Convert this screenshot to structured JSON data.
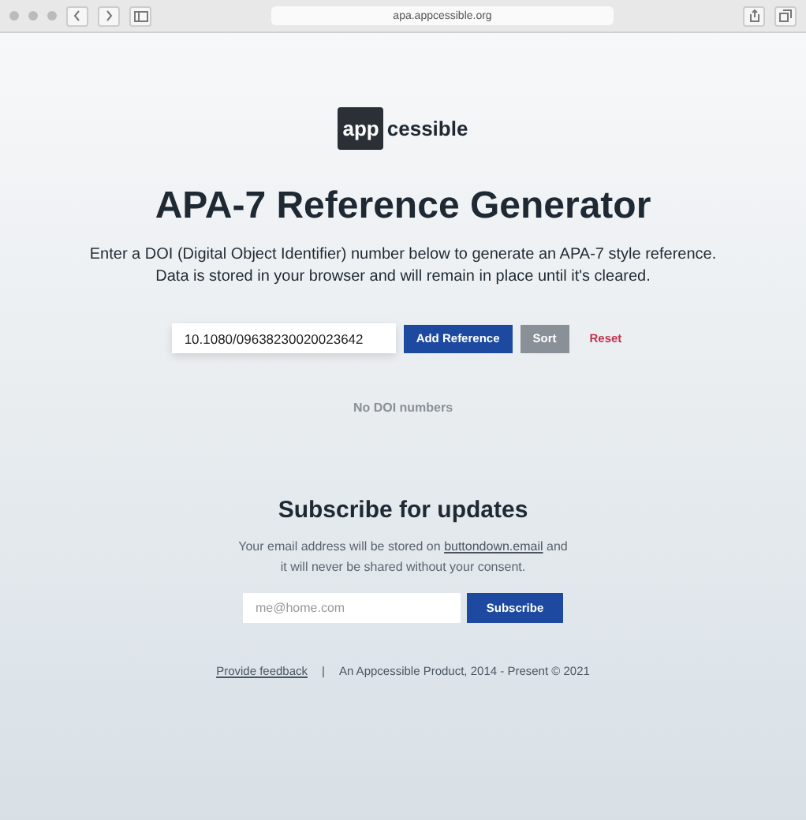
{
  "browser": {
    "url": "apa.appcessible.org"
  },
  "logo": {
    "box_text": "app",
    "rest_text": "cessible"
  },
  "title": "APA-7 Reference Generator",
  "intro": [
    "Enter a DOI (Digital Object Identifier) number below to generate an APA-7 style reference.",
    "Data is stored in your browser and will remain in place until it's cleared."
  ],
  "doi_input": {
    "value": "10.1080/09638230020023642"
  },
  "buttons": [
    {
      "kind": "primary",
      "label": "Add Reference"
    },
    {
      "kind": "secondary",
      "label": "Sort"
    },
    {
      "kind": "danger",
      "label": "Reset"
    }
  ],
  "empty_text": "No DOI numbers",
  "subscribe": {
    "heading": "Subscribe for updates",
    "note_before": "Your email address will be stored on",
    "note_link": "buttondown.email",
    "note_after": "and it will never be shared without your consent.",
    "placeholder": "me@home.com",
    "button": "Subscribe"
  },
  "footer": {
    "link": "Provide feedback",
    "separator": "|",
    "text": "An Appcessible Product, 2014 - Present © 2021"
  }
}
